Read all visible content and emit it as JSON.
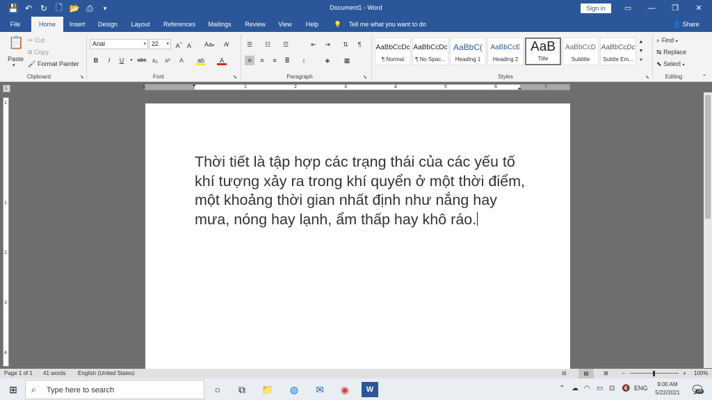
{
  "window": {
    "title": "Document1 - Word",
    "sign_in": "Sign in"
  },
  "tabs": [
    "File",
    "Home",
    "Insert",
    "Design",
    "Layout",
    "References",
    "Mailings",
    "Review",
    "View",
    "Help"
  ],
  "tell_me": "Tell me what you want to do",
  "share": "Share",
  "clipboard": {
    "paste": "Paste",
    "cut": "Cut",
    "copy": "Copy",
    "format_painter": "Format Painter",
    "label": "Clipboard"
  },
  "font": {
    "name": "Arial",
    "size": "22",
    "case": "Aa",
    "label": "Font"
  },
  "paragraph": {
    "label": "Paragraph"
  },
  "styles": {
    "label": "Styles",
    "items": [
      {
        "preview": "AaBbCcDc",
        "name": "¶ Normal"
      },
      {
        "preview": "AaBbCcDc",
        "name": "¶ No Spac..."
      },
      {
        "preview": "AaBbC(",
        "name": "Heading 1"
      },
      {
        "preview": "AaBbCcE",
        "name": "Heading 2"
      },
      {
        "preview": "AaB",
        "name": "Title"
      },
      {
        "preview": "AaBbCcD",
        "name": "Subtitle"
      },
      {
        "preview": "AaBbCcDc",
        "name": "Subtle Em..."
      }
    ]
  },
  "editing": {
    "find": "Find",
    "replace": "Replace",
    "select": "Select",
    "label": "Editing"
  },
  "ruler": {
    "h_marks": [
      "1",
      "1",
      "2",
      "3",
      "4",
      "5",
      "6",
      "7"
    ],
    "v_marks": [
      "1",
      "1",
      "2",
      "3",
      "4"
    ]
  },
  "document": {
    "text": "Thời tiết là tập hợp các trạng thái của các yếu tố khí tượng xảy ra trong khí quyển ở một thời điểm, một khoảng thời gian nhất định như nắng hay mưa, nóng hay lạnh, ẩm thấp hay khô ráo."
  },
  "status": {
    "page": "Page 1 of 1",
    "words": "41 words",
    "language": "English (United States)",
    "zoom": "100%"
  },
  "taskbar": {
    "search_placeholder": "Type here to search",
    "language": "ENG",
    "time": "9:00 AM",
    "date": "5/22/2021",
    "notifications": "28"
  },
  "colors": {
    "accent": "#2b579a",
    "ribbon_bg": "#f3f3f3",
    "canvas": "#6e6e6e"
  }
}
